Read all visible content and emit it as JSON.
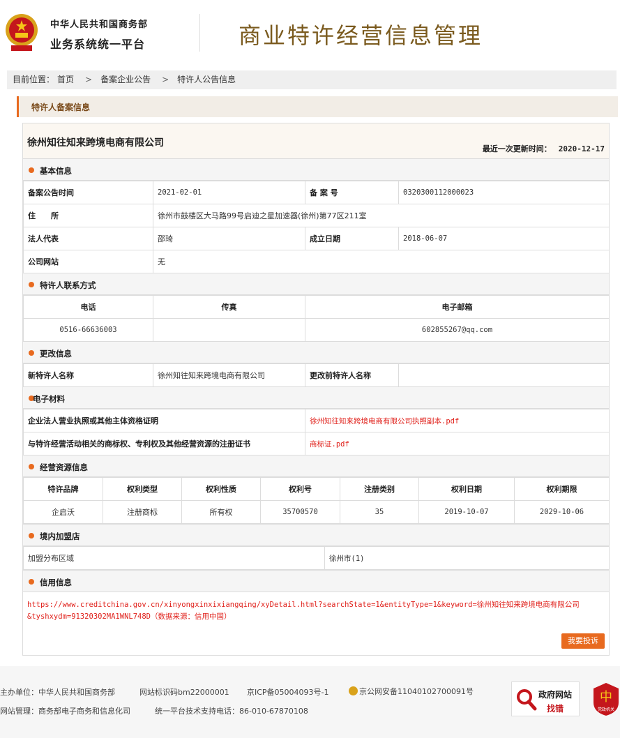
{
  "header": {
    "org_line1": "中华人民共和国商务部",
    "org_line2": "业务系统统一平台",
    "system_title": "商业特许经营信息管理"
  },
  "breadcrumb": {
    "prefix": "目前位置：",
    "items": [
      "首页",
      "备案企业公告",
      "特许人公告信息"
    ],
    "separator": ">"
  },
  "section_title": "特许人备案信息",
  "company": {
    "name": "徐州知往知来跨境电商有限公司",
    "update_label": "最近一次更新时间：",
    "update_date": "2020-12-17"
  },
  "basic_info": {
    "title": "基本信息",
    "publish_time_label": "备案公告时间",
    "publish_time": "2021-02-01",
    "record_no_label": "备 案 号",
    "record_no": "0320300112000023",
    "address_label": "住　　所",
    "address": "徐州市鼓楼区大马路99号启迪之星加速器(徐州)第77区211室",
    "legal_rep_label": "法人代表",
    "legal_rep": "邵琦",
    "founded_label": "成立日期",
    "founded": "2018-06-07",
    "website_label": "公司网站",
    "website": "无"
  },
  "contact": {
    "title": "特许人联系方式",
    "headers": [
      "电话",
      "传真",
      "电子邮箱"
    ],
    "phone": "0516-66636003",
    "fax": "",
    "email": "602855267@qq.com"
  },
  "change": {
    "title": "更改信息",
    "new_name_label": "新特许人名称",
    "new_name": "徐州知往知来跨境电商有限公司",
    "old_name_label": "更改前特许人名称",
    "old_name": ""
  },
  "materials": {
    "title": "电子材料",
    "license_label": "企业法人营业执照或其他主体资格证明",
    "license_file": "徐州知往知来跨境电商有限公司执照副本.pdf",
    "ip_label": "与特许经营活动相关的商标权、专利权及其他经营资源的注册证书",
    "ip_file": "商标证.pdf"
  },
  "resources": {
    "title": "经营资源信息",
    "headers": [
      "特许品牌",
      "权利类型",
      "权利性质",
      "权利号",
      "注册类别",
      "权利日期",
      "权利期限"
    ],
    "rows": [
      [
        "企启沃",
        "注册商标",
        "所有权",
        "35700570",
        "35",
        "2019-10-07",
        "2029-10-06"
      ]
    ]
  },
  "domestic": {
    "title": "境内加盟店",
    "area_label": "加盟分布区域",
    "area_value": "徐州市(1)"
  },
  "credit": {
    "title": "信用信息",
    "line1": "https://www.creditchina.gov.cn/xinyongxinxixiangqing/xyDetail.html?searchState=1&entityType=1&keyword=徐州知往知来跨境电商有限公司",
    "line2": "&tyshxydm=91320302MA1WNL748D（数据来源：信用中国）",
    "report_button": "我要投诉"
  },
  "footer": {
    "sponsor": "主办单位：中华人民共和国商务部",
    "site_id": "网站标识码bm22000001",
    "icp": "京ICP备05004093号-1",
    "police": "京公网安备11040102700091号",
    "management": "网站管理：商务部电子商务和信息化司",
    "support": "统一平台技术支持电话：86-010-67870108",
    "gov_badge_line1": "政府网站",
    "gov_badge_line2": "找错",
    "party_badge_label": "党政机关",
    "colors": {
      "accent": "#e86a1f",
      "link": "#e0211b",
      "title_brown": "#7a5a1e"
    }
  }
}
